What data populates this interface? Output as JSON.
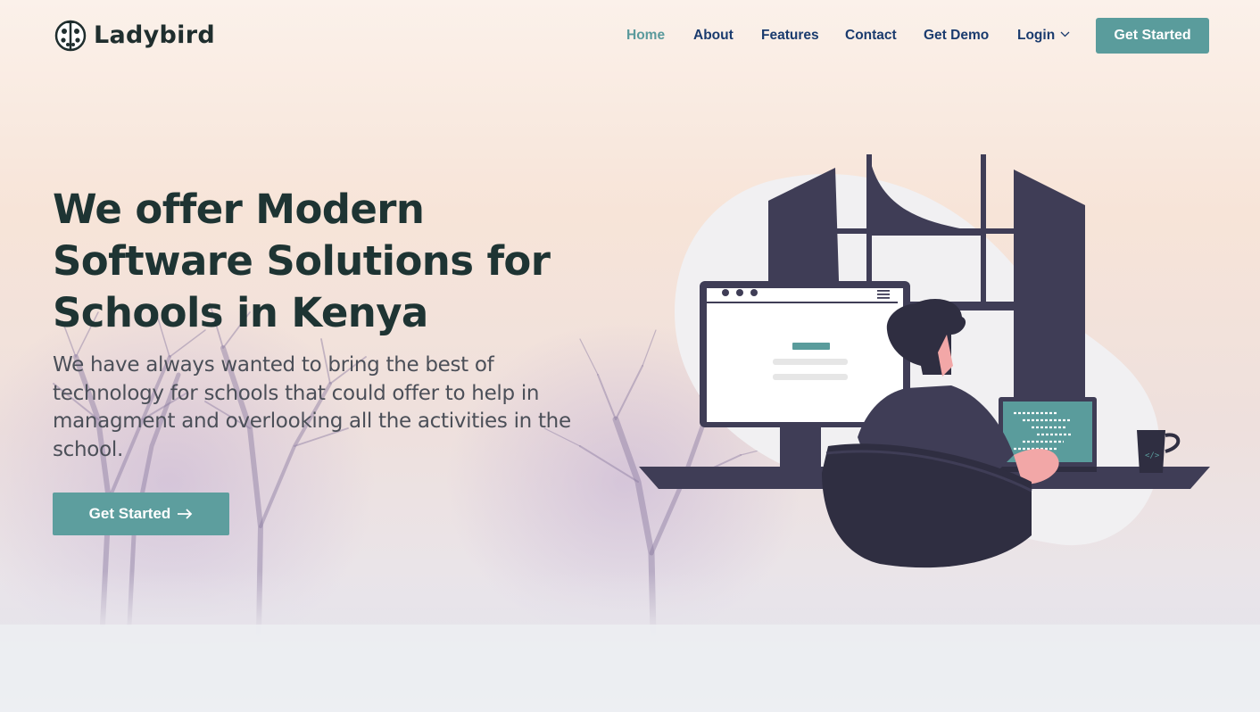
{
  "brand": {
    "name": "Ladybird",
    "logo_icon": "ladybug-icon"
  },
  "nav": {
    "items": [
      {
        "label": "Home",
        "active": true
      },
      {
        "label": "About",
        "active": false
      },
      {
        "label": "Features",
        "active": false
      },
      {
        "label": "Contact",
        "active": false
      },
      {
        "label": "Get Demo",
        "active": false
      },
      {
        "label": "Login",
        "active": false,
        "has_dropdown": true
      }
    ],
    "cta_label": "Get Started"
  },
  "hero": {
    "title": "We offer Modern Software Solutions for Schools in Kenya",
    "description": "We have always wanted to bring the best of technology for schools that could offer to help in managment and overlooking all the activities in the school.",
    "button_label": "Get Started",
    "button_icon": "arrow-right-icon"
  },
  "colors": {
    "accent": "#5a9c9c",
    "nav_text": "#1a3b6e",
    "heading": "#1e3433",
    "illustration_dark": "#3f3d56"
  }
}
